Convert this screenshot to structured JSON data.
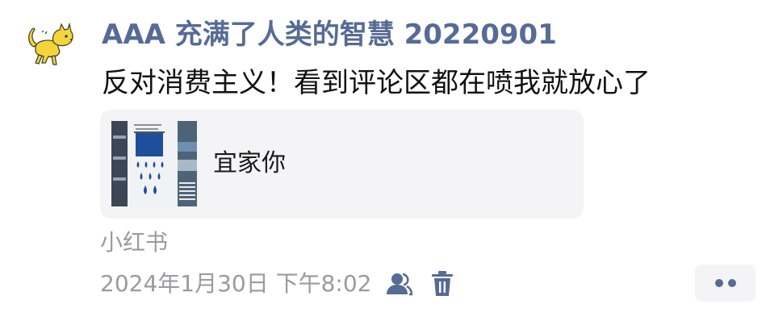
{
  "post": {
    "author": "AAA 充满了人类的智慧 20220901",
    "text": "反对消费主义！看到评论区都在喷我就放心了",
    "link_card": {
      "title": "宜家你",
      "thumbnail_icon": "store-shelf-image"
    },
    "source": "小红书",
    "timestamp": "2024年1月30日 下午8:02",
    "icons": {
      "avatar": "cat-avatar",
      "visibility": "people-icon",
      "delete": "trash-icon",
      "more": "more-dots-icon"
    },
    "colors": {
      "author_name": "#566b95",
      "meta_text": "#9a9a9f",
      "card_background": "#f4f4f6",
      "avatar_yellow": "#f5d43a"
    }
  }
}
